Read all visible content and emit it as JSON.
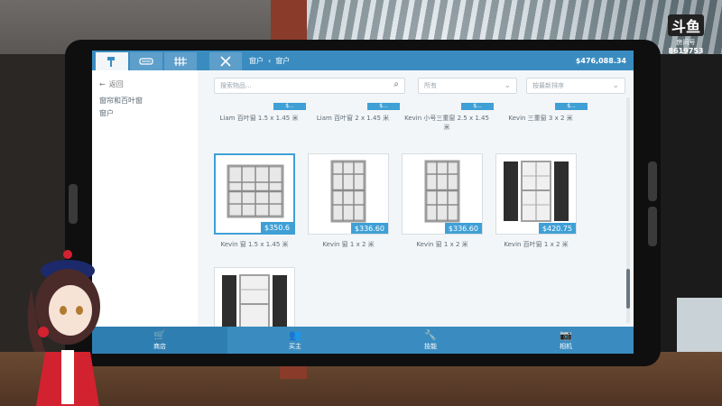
{
  "app": {
    "balance": "$476,088.34",
    "breadcrumb": [
      "窗户",
      "窗户"
    ]
  },
  "tabs": [
    {
      "name": "hammer",
      "icon": "hammer-icon",
      "active": true
    },
    {
      "name": "paint",
      "icon": "paint-icon",
      "active": false
    },
    {
      "name": "fence",
      "icon": "fence-icon",
      "active": false
    },
    {
      "name": "tools",
      "icon": "tools-icon",
      "active": false
    }
  ],
  "sidebar": {
    "back_label": "返回",
    "items": [
      "窗帘和百叶窗",
      "窗户"
    ]
  },
  "filters": {
    "search_placeholder": "搜索物品...",
    "category_placeholder": "所有",
    "sort_placeholder": "按最新排序"
  },
  "top_row": [
    {
      "name": "Liam 百叶窗 1.5 x 1.45 米",
      "price": "$..."
    },
    {
      "name": "Liam 百叶窗 2 x 1.45 米",
      "price": "$..."
    },
    {
      "name": "Kevin 小号三重窗 2.5 x 1.45 米",
      "price": "$..."
    },
    {
      "name": "Kevin 三重窗 3 x 2 米",
      "price": "$..."
    }
  ],
  "products": [
    {
      "name": "Kevin 窗 1.5 x 1.45 米",
      "price": "$350.6",
      "selected": true
    },
    {
      "name": "Kevin 窗 1 x 2 米",
      "price": "$336.60",
      "selected": false
    },
    {
      "name": "Kevin 窗 1 x 2 米",
      "price": "$336.60",
      "selected": false
    },
    {
      "name": "Kevin 百叶窗 1 x 2 米",
      "price": "$420.75",
      "selected": false
    }
  ],
  "nav": [
    {
      "label": "商店",
      "icon": "cart-icon",
      "active": true
    },
    {
      "label": "买主",
      "icon": "people-icon",
      "active": false
    },
    {
      "label": "技能",
      "icon": "wrench-icon",
      "active": false
    },
    {
      "label": "相机",
      "icon": "camera-icon",
      "active": false
    }
  ],
  "watermark": {
    "logo": "斗鱼",
    "room_label": "房间号",
    "room_id": "8619753"
  }
}
